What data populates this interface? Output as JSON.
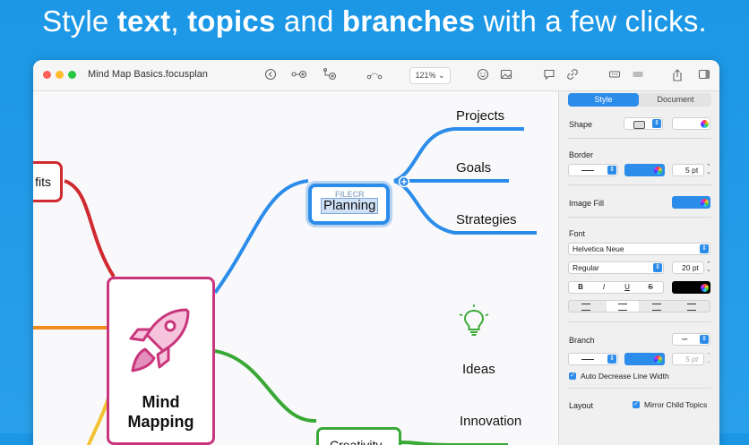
{
  "headline": {
    "part1": "Style ",
    "b1": "text",
    "part2": ", ",
    "b2": "topics",
    "part3": " and ",
    "b3": "branches",
    "part4": " with a few clicks."
  },
  "window": {
    "title": "Mind Map Basics.focusplan",
    "zoom": "121%"
  },
  "mindmap": {
    "central": {
      "line1": "Mind",
      "line2": "Mapping"
    },
    "benefits_partial": "fits",
    "planning": "Planning",
    "planning_children": [
      "Projects",
      "Goals",
      "Strategies"
    ],
    "creativity": "Creativity",
    "creativity_children": [
      "Ideas",
      "Innovation"
    ],
    "watermark": "FILECR",
    "colors": {
      "central": "#c8357c",
      "planning": "#2c8cea",
      "creativity": "#39a836",
      "benefits": "#d02a30",
      "orange": "#f08a1c",
      "yellow": "#f2c230"
    }
  },
  "inspector": {
    "tabs": [
      "Style",
      "Document"
    ],
    "shape_label": "Shape",
    "border_label": "Border",
    "border_width": "5 pt",
    "image_fill_label": "Image Fill",
    "font_label": "Font",
    "font_family": "Helvetica Neue",
    "font_style": "Regular",
    "font_size": "20 pt",
    "format_buttons": [
      "B",
      "I",
      "U",
      "S"
    ],
    "align_buttons": [
      "align-left",
      "align-center",
      "align-right",
      "align-justify"
    ],
    "branch_label": "Branch",
    "branch_width": "5 pt",
    "auto_decrease": "Auto Decrease Line Width",
    "layout_label": "Layout",
    "mirror_child": "Mirror Child Topics",
    "accent": "#2c8cea"
  }
}
